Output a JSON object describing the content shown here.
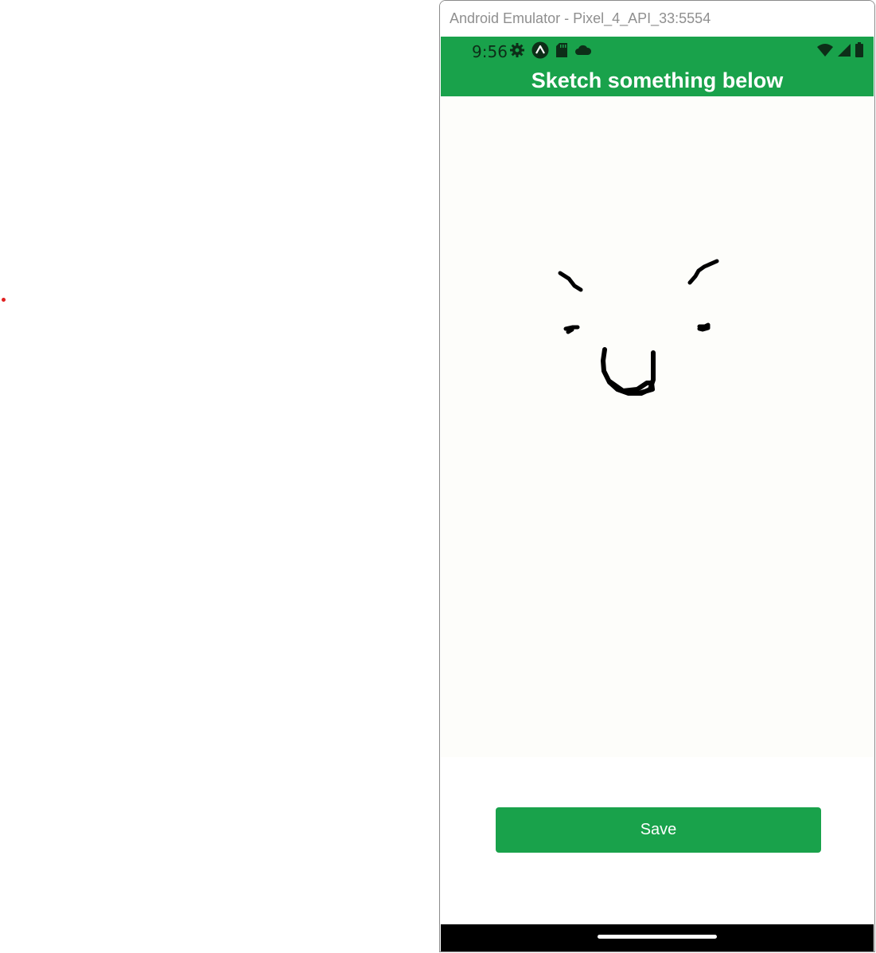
{
  "window": {
    "title": "Android Emulator - Pixel_4_API_33:5554"
  },
  "status_bar": {
    "time": "9:56",
    "left_icons": [
      "settings-gear-icon",
      "app-notification-icon",
      "sd-card-icon",
      "cloud-icon"
    ],
    "right_icons": [
      "wifi-icon",
      "cellular-signal-icon",
      "battery-icon"
    ]
  },
  "app": {
    "title": "Sketch something below",
    "save_label": "Save"
  },
  "colors": {
    "accent_green": "#19a24b",
    "canvas_background": "#fdfdfa",
    "stroke": "#000000"
  },
  "sketch": {
    "stroke_count": 5,
    "content": "hand-drawn face: two eyebrows, two eyes, smiling mouth"
  }
}
